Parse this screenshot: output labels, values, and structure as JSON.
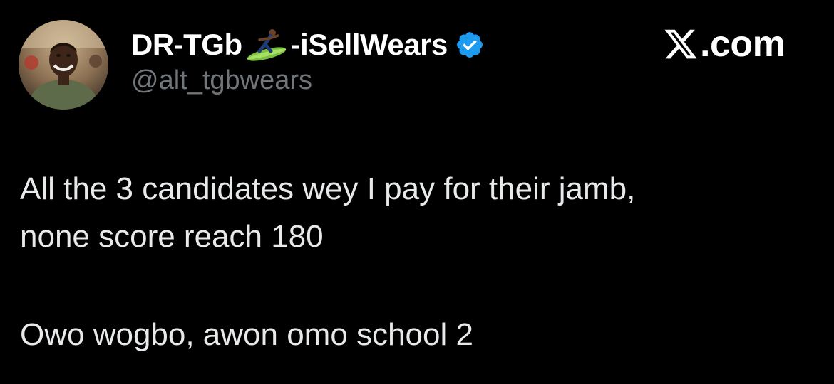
{
  "author": {
    "display_name_prefix": "DR-TGb",
    "display_name_emoji": "surfer-emoji-icon",
    "display_name_suffix": "-iSellWears",
    "verified_badge": "verified-badge-icon",
    "verified_color": "#1d9bf0",
    "handle": "@alt_tgbwears",
    "avatar": "profile-photo"
  },
  "brand": {
    "logo_icon": "x-logo-icon",
    "label": ".com"
  },
  "tweet": {
    "paragraphs": [
      [
        "All the 3 candidates wey I pay for their jamb,",
        "none score reach 180"
      ],
      [
        "Owo wogbo, awon omo school 2"
      ]
    ]
  },
  "colors": {
    "background": "#000000",
    "name": "#ffffff",
    "handle": "#71767b",
    "body_text": "#e7e9ea"
  }
}
